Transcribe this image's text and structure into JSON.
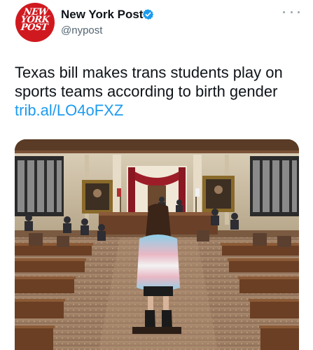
{
  "author": {
    "avatar_lines": [
      "NEW",
      "YORK",
      "POST"
    ],
    "display_name": "New York Post",
    "handle": "@nypost",
    "verified": true
  },
  "tweet": {
    "text_lines": [
      "Texas bill makes trans students play on",
      "sports teams according to birth gender"
    ],
    "link": "trib.al/LO4oFXZ"
  },
  "media": {
    "kind": "photo"
  },
  "icons": {
    "verified": "verified-badge-icon",
    "more": "more-options-icon"
  },
  "colors": {
    "brand_red": "#d0191f",
    "link_blue": "#1d9bf0",
    "verified_blue": "#1d9bf0",
    "secondary_text": "#536471"
  }
}
